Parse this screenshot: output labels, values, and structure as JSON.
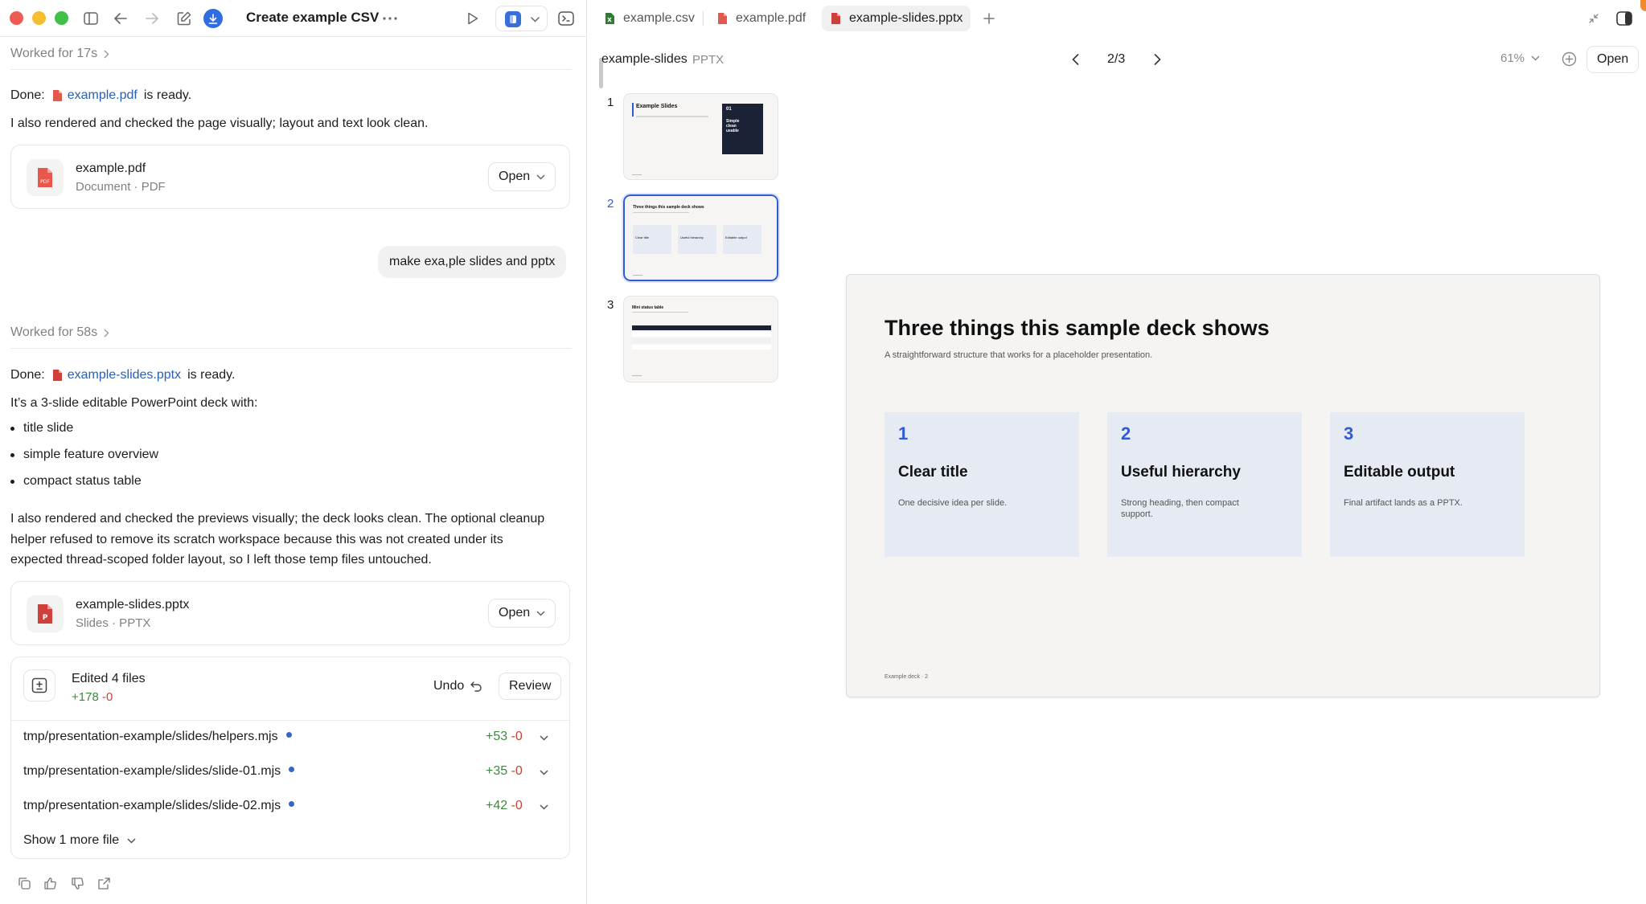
{
  "window": {
    "title": "Create example CSV"
  },
  "chat": {
    "worked1": "Worked for 17s",
    "done1_prefix": "Done:",
    "done1_file": "example.pdf",
    "done1_suffix": "is ready.",
    "msg1": "I also rendered and checked the page visually; layout and text look clean.",
    "card_pdf": {
      "name": "example.pdf",
      "meta": "Document · PDF",
      "open": "Open",
      "icon_label": "PDF"
    },
    "user_message": "make exa,ple slides and pptx",
    "worked2": "Worked for 58s",
    "done2_prefix": "Done:",
    "done2_file": "example-slides.pptx",
    "done2_suffix": "is ready.",
    "intro": "It’s a 3-slide editable PowerPoint deck with:",
    "bullets": [
      "title slide",
      "simple feature overview",
      "compact status table"
    ],
    "para_lines": [
      "I also rendered and checked the previews visually; the deck looks clean. The optional cleanup",
      "helper refused to remove its scratch workspace because this was not created under its",
      "expected thread-scoped folder layout, so I left those temp files untouched."
    ],
    "card_pptx": {
      "name": "example-slides.pptx",
      "meta": "Slides · PPTX",
      "open": "Open",
      "icon_label": "P"
    },
    "edits": {
      "title": "Edited 4 files",
      "added": "+178",
      "removed": "-0",
      "undo": "Undo",
      "review": "Review",
      "files": [
        {
          "path": "tmp/presentation-example/slides/helpers.mjs",
          "added": "+53",
          "removed": "-0"
        },
        {
          "path": "tmp/presentation-example/slides/slide-01.mjs",
          "added": "+35",
          "removed": "-0"
        },
        {
          "path": "tmp/presentation-example/slides/slide-02.mjs",
          "added": "+42",
          "removed": "-0"
        }
      ],
      "more": "Show 1 more file"
    }
  },
  "tabs": [
    {
      "label": "example.csv",
      "icon": "csv-file-icon",
      "color": "#2e7d32"
    },
    {
      "label": "example.pdf",
      "icon": "pdf-file-icon",
      "color": "#e05a4e"
    },
    {
      "label": "example-slides.pptx",
      "icon": "pptx-file-icon",
      "color": "#d0403a"
    }
  ],
  "viewer": {
    "doc_name": "example-slides",
    "doc_type": "PPTX",
    "page": "2/3",
    "zoom": "61%",
    "open": "Open",
    "thumb_numbers": [
      "1",
      "2",
      "3"
    ],
    "thumb1": {
      "title": "Example Slides",
      "box_num": "01",
      "box_lines": [
        "Simple",
        "clean",
        "usable"
      ]
    },
    "thumb2": {
      "title": "Three things this sample deck shows",
      "cards": [
        "Clear title",
        "Useful hierarchy",
        "Editable output"
      ]
    },
    "thumb3": {
      "title": "Mini status table"
    }
  },
  "slide": {
    "title": "Three things this sample deck shows",
    "subtitle": "A straightforward structure that works for a placeholder presentation.",
    "cards": [
      {
        "num": "1",
        "title": "Clear title",
        "desc": "One decisive idea per slide."
      },
      {
        "num": "2",
        "title": "Useful hierarchy",
        "desc": "Strong heading, then compact support."
      },
      {
        "num": "3",
        "title": "Editable output",
        "desc": "Final artifact lands as a PPTX."
      }
    ],
    "footer": "Example deck · 2"
  },
  "colors": {
    "accent": "#2f5bd3",
    "link": "#2860b4",
    "added": "#3d8a3d",
    "removed": "#c4463a",
    "selected_thumb": "#2f5bd3"
  }
}
